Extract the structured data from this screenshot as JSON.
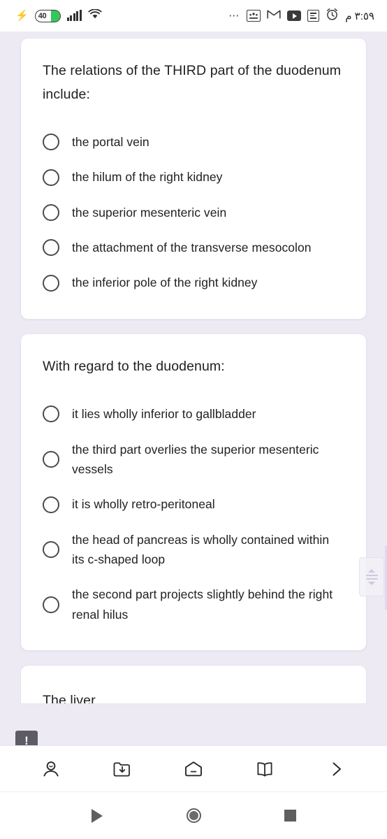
{
  "status_bar": {
    "charging_icon": "bolt-icon",
    "battery_level": "40",
    "signal_icon": "cellular-signal-icon",
    "wifi_icon": "wifi-icon",
    "overflow_icon": "more-dots-icon",
    "classroom_icon": "google-classroom-icon",
    "gmail_icon": "gmail-icon",
    "youtube_icon": "youtube-icon",
    "tasks_icon": "tasks-icon",
    "alarm_icon": "alarm-clock-icon",
    "time": "٣:٥٩ م"
  },
  "cards": [
    {
      "question": "The relations of the THIRD part of the duodenum include:",
      "options": [
        "the portal vein",
        "the hilum of the right kidney",
        "the superior mesenteric vein",
        "the attachment of the transverse mesocolon",
        "the inferior pole of the right kidney"
      ]
    },
    {
      "question": "With regard to the duodenum:",
      "options": [
        "it lies wholly inferior to gallbladder",
        "the third part overlies the superior mesenteric vessels",
        "it is wholly retro-peritoneal",
        "the head of pancreas is wholly contained within its c-shaped loop",
        "the second part projects slightly behind the right renal hilus"
      ]
    }
  ],
  "partial_card": {
    "question": "The liver"
  },
  "hint": {
    "icon": "exclamation-bubble-icon",
    "symbol": "!"
  },
  "scroll_widget": {
    "icon": "scroll-thumb-handle"
  },
  "app_nav": [
    {
      "name": "account-icon",
      "label": "Account"
    },
    {
      "name": "downloads-icon",
      "label": "Downloads"
    },
    {
      "name": "home-icon",
      "label": "Home"
    },
    {
      "name": "library-icon",
      "label": "Library"
    },
    {
      "name": "next-icon",
      "label": "Next"
    }
  ],
  "system_nav": [
    {
      "name": "back-icon",
      "label": "Back"
    },
    {
      "name": "home-circle-icon",
      "label": "Home"
    },
    {
      "name": "recents-icon",
      "label": "Recents"
    }
  ],
  "colors": {
    "page_background": "#edeaf4",
    "card_background": "#ffffff",
    "text_primary": "#202124",
    "battery_green": "#34c759",
    "hint_bubble": "#5c5b66"
  }
}
